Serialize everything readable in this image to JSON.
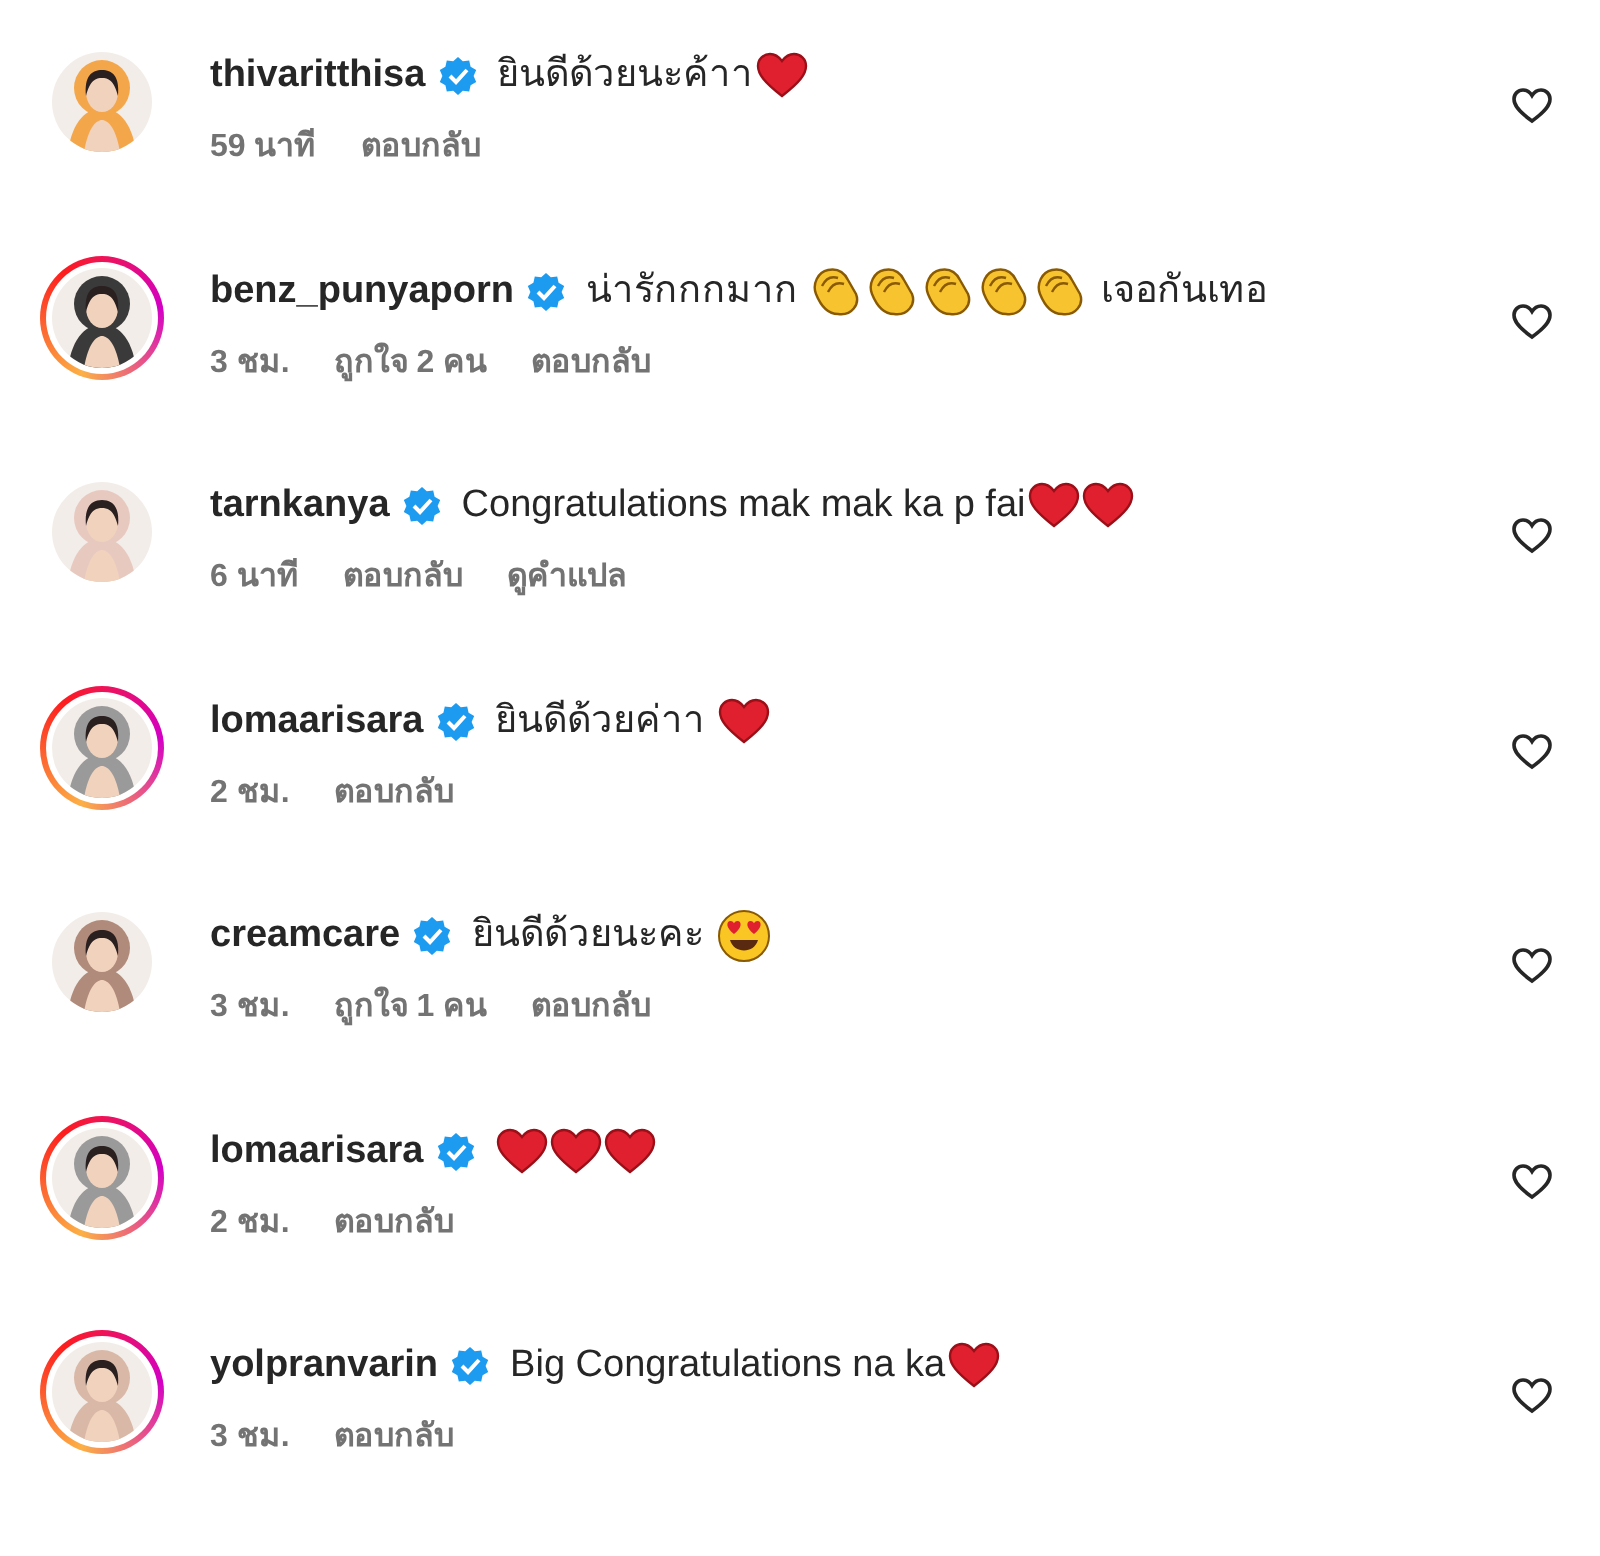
{
  "comments": [
    {
      "username": "thivaritthisa",
      "verified": true,
      "story_ring": false,
      "parts": [
        {
          "kind": "text",
          "text": "ยินดีด้วยนะค้าา"
        },
        {
          "kind": "heart"
        }
      ],
      "meta": [
        "59 นาที",
        "ตอบกลับ"
      ]
    },
    {
      "username": "benz_punyaporn",
      "verified": true,
      "story_ring": true,
      "parts": [
        {
          "kind": "text",
          "text": "น่ารักกกมาก "
        },
        {
          "kind": "clap"
        },
        {
          "kind": "clap"
        },
        {
          "kind": "clap"
        },
        {
          "kind": "clap"
        },
        {
          "kind": "clap"
        },
        {
          "kind": "text",
          "text": " เจอกันเทอ"
        }
      ],
      "meta": [
        "3 ชม.",
        "ถูกใจ 2 คน",
        "ตอบกลับ"
      ]
    },
    {
      "username": "tarnkanya",
      "verified": true,
      "story_ring": false,
      "parts": [
        {
          "kind": "text",
          "text": "Congratulations mak mak ka p fai"
        },
        {
          "kind": "heart"
        },
        {
          "kind": "heart"
        }
      ],
      "meta": [
        "6 นาที",
        "ตอบกลับ",
        "ดูคำแปล"
      ]
    },
    {
      "username": "lomaarisara",
      "verified": true,
      "story_ring": true,
      "parts": [
        {
          "kind": "text",
          "text": "ยินดีด้วยค่าา "
        },
        {
          "kind": "heart"
        }
      ],
      "meta": [
        "2 ชม.",
        "ตอบกลับ"
      ]
    },
    {
      "username": "creamcare",
      "verified": true,
      "story_ring": false,
      "parts": [
        {
          "kind": "text",
          "text": "ยินดีด้วยนะคะ "
        },
        {
          "kind": "heart-eyes"
        }
      ],
      "meta": [
        "3 ชม.",
        "ถูกใจ 1 คน",
        "ตอบกลับ"
      ]
    },
    {
      "username": "lomaarisara",
      "verified": true,
      "story_ring": true,
      "parts": [
        {
          "kind": "heart"
        },
        {
          "kind": "heart"
        },
        {
          "kind": "heart"
        }
      ],
      "meta": [
        "2 ชม.",
        "ตอบกลับ"
      ]
    },
    {
      "username": "yolpranvarin",
      "verified": true,
      "story_ring": true,
      "parts": [
        {
          "kind": "text",
          "text": "Big Congratulations na ka"
        },
        {
          "kind": "heart"
        }
      ],
      "meta": [
        "3 ชม.",
        "ตอบกลับ"
      ]
    }
  ]
}
